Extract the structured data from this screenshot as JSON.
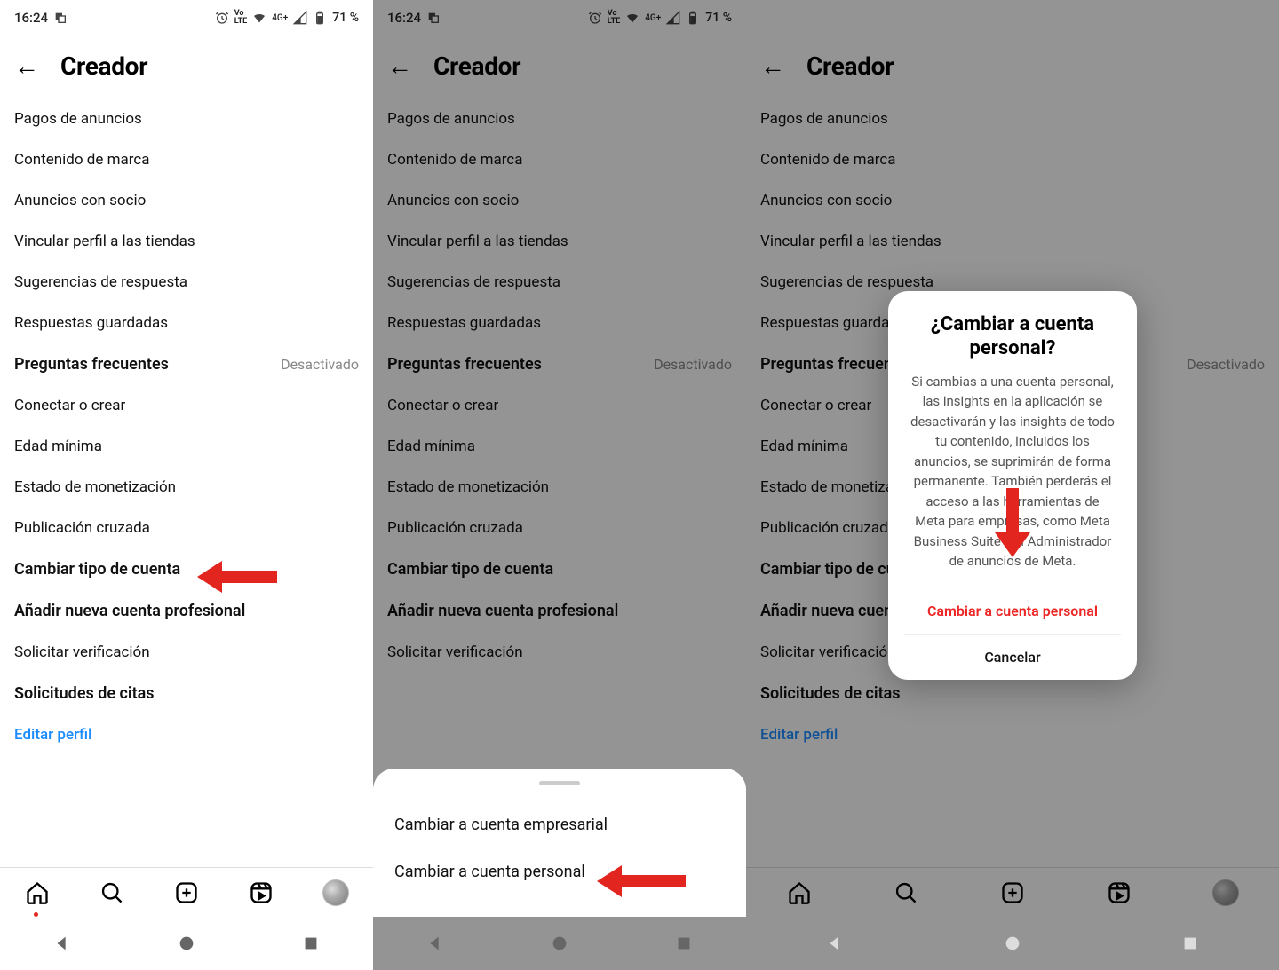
{
  "statusbar": {
    "time": "16:24",
    "battery": "71 %",
    "network": "4G+",
    "lte": "VoLTE"
  },
  "header": {
    "title": "Creador"
  },
  "menu": {
    "items": [
      {
        "label": "Pagos de anuncios",
        "bold": false
      },
      {
        "label": "Contenido de marca",
        "bold": false
      },
      {
        "label": "Anuncios con socio",
        "bold": false
      },
      {
        "label": "Vincular perfil a las tiendas",
        "bold": false
      },
      {
        "label": "Sugerencias de respuesta",
        "bold": false
      },
      {
        "label": "Respuestas guardadas",
        "bold": false
      },
      {
        "label": "Preguntas frecuentes",
        "bold": true,
        "status": "Desactivado"
      },
      {
        "label": "Conectar o crear",
        "bold": false
      },
      {
        "label": "Edad mínima",
        "bold": false
      },
      {
        "label": "Estado de monetización",
        "bold": false
      },
      {
        "label": "Publicación cruzada",
        "bold": false
      },
      {
        "label": "Cambiar tipo de cuenta",
        "bold": true
      },
      {
        "label": "Añadir nueva cuenta profesional",
        "bold": true
      },
      {
        "label": "Solicitar verificación",
        "bold": false
      },
      {
        "label": "Solicitudes de citas",
        "bold": true
      }
    ],
    "edit_profile": "Editar perfil"
  },
  "sheet": {
    "option_business": "Cambiar a cuenta empresarial",
    "option_personal": "Cambiar a cuenta personal"
  },
  "modal": {
    "title": "¿Cambiar a cuenta personal?",
    "body": "Si cambias a una cuenta personal, las insights en la aplicación se desactivarán y las insights de todo tu contenido, incluidos los anuncios, se suprimirán de forma permanente. También perderás el acceso a las herramientas de Meta para empresas, como Meta Business Suite y el Administrador de anuncios de Meta.",
    "confirm": "Cambiar a cuenta personal",
    "cancel": "Cancelar"
  },
  "annotations": {
    "arrow_color": "#e2261f"
  }
}
